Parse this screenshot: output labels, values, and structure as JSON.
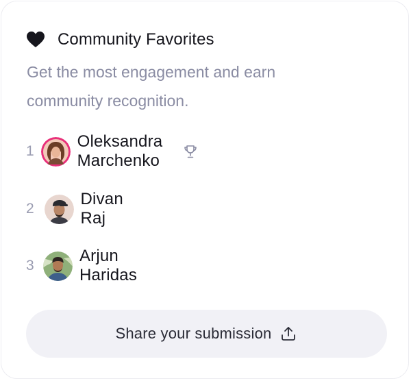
{
  "card": {
    "title": "Community Favorites",
    "icon": "heart-icon",
    "subtitle": "Get the most engagement and earn community recognition."
  },
  "leaderboard": [
    {
      "rank": "1",
      "name": "Oleksandra Marchenko",
      "badge_icon": "trophy-icon"
    },
    {
      "rank": "2",
      "name": "Divan Raj"
    },
    {
      "rank": "3",
      "name": "Arjun Haridas"
    }
  ],
  "share_button": {
    "label": "Share your submission",
    "icon": "upload-icon"
  },
  "colors": {
    "title": "#16161d",
    "subtitle": "#8a8ca3",
    "rank": "#9a9cb1",
    "button_bg": "#f1f1f6",
    "avatar_1_ring": "#e8307a"
  }
}
